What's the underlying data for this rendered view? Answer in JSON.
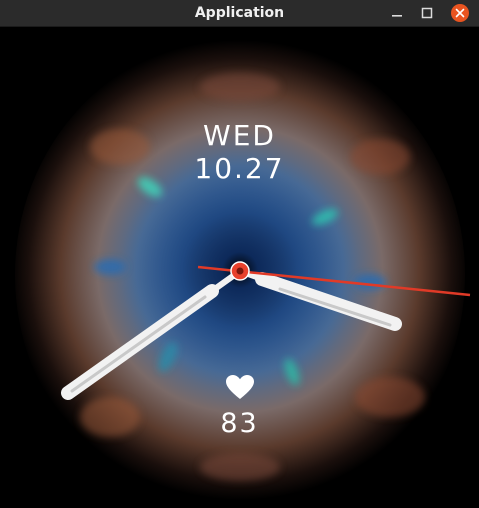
{
  "window": {
    "title": "Application",
    "controls": [
      "minimize-icon",
      "maximize-icon",
      "close-icon"
    ]
  },
  "watchface": {
    "day": "WED",
    "date": "10.27",
    "heart_rate": "83",
    "heart_icon": "heart-icon",
    "accent_color": "#e8412c",
    "hand_color": "#f2f2f2"
  }
}
